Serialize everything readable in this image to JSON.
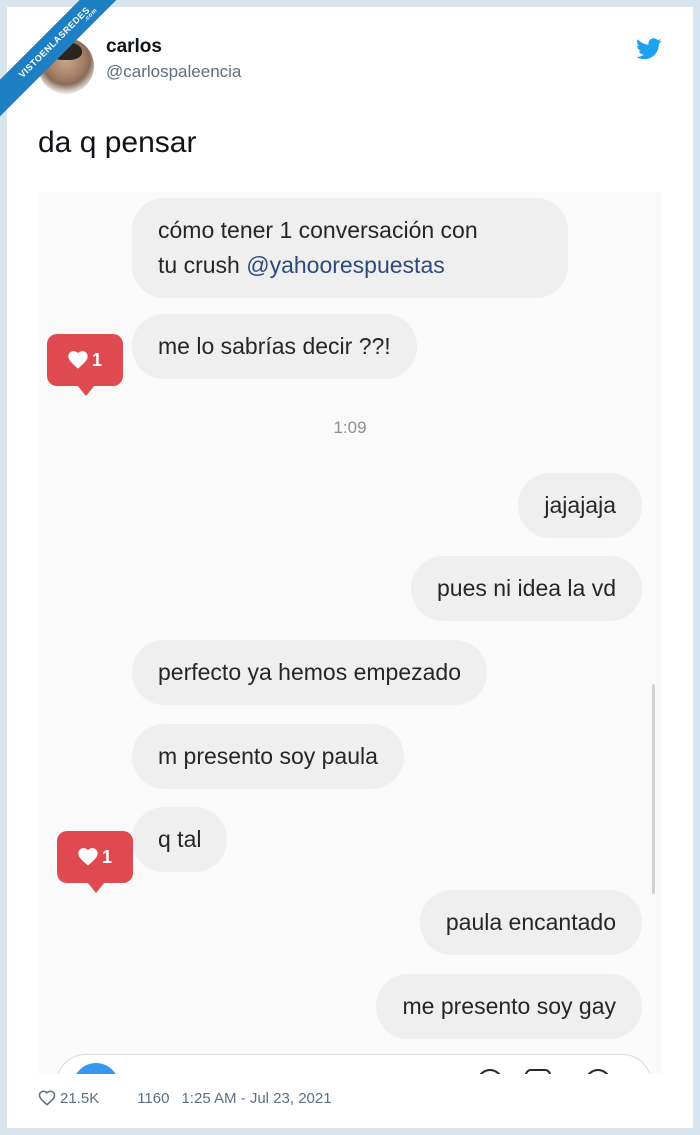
{
  "watermark": {
    "text": "VISTOENLASREDES",
    "suffix": ".com"
  },
  "author": {
    "name": "carlos",
    "handle": "@carlospaleencia"
  },
  "tweet": {
    "text": "da q pensar"
  },
  "chat": {
    "messages": [
      {
        "side": "left",
        "lines": [
          "cómo tener 1 conversación con",
          "tu crush "
        ],
        "mention": "@yahoorespuestas"
      },
      {
        "side": "left",
        "text": "me lo sabrías decir ??!",
        "likes": "1"
      },
      {
        "side": "right",
        "text": "jajajaja"
      },
      {
        "side": "right",
        "text": "pues ni idea la vd"
      },
      {
        "side": "left",
        "text": "perfecto ya hemos empezado"
      },
      {
        "side": "left",
        "text": "m presento soy paula"
      },
      {
        "side": "left",
        "text": "q tal",
        "likes": "1"
      },
      {
        "side": "right",
        "text": "paula encantado"
      },
      {
        "side": "right",
        "text": "me presento soy gay"
      }
    ],
    "timestamp": "1:09"
  },
  "footer": {
    "likes": "21.5K",
    "retweets": "1160",
    "datetime": "1:25 AM - Jul 23, 2021"
  },
  "colors": {
    "accent": "#1da1f2",
    "like_badge": "#de4a4f",
    "mention": "#2f4a7a"
  },
  "icons": {
    "bird": "twitter-bird-icon",
    "heart": "heart-icon"
  }
}
